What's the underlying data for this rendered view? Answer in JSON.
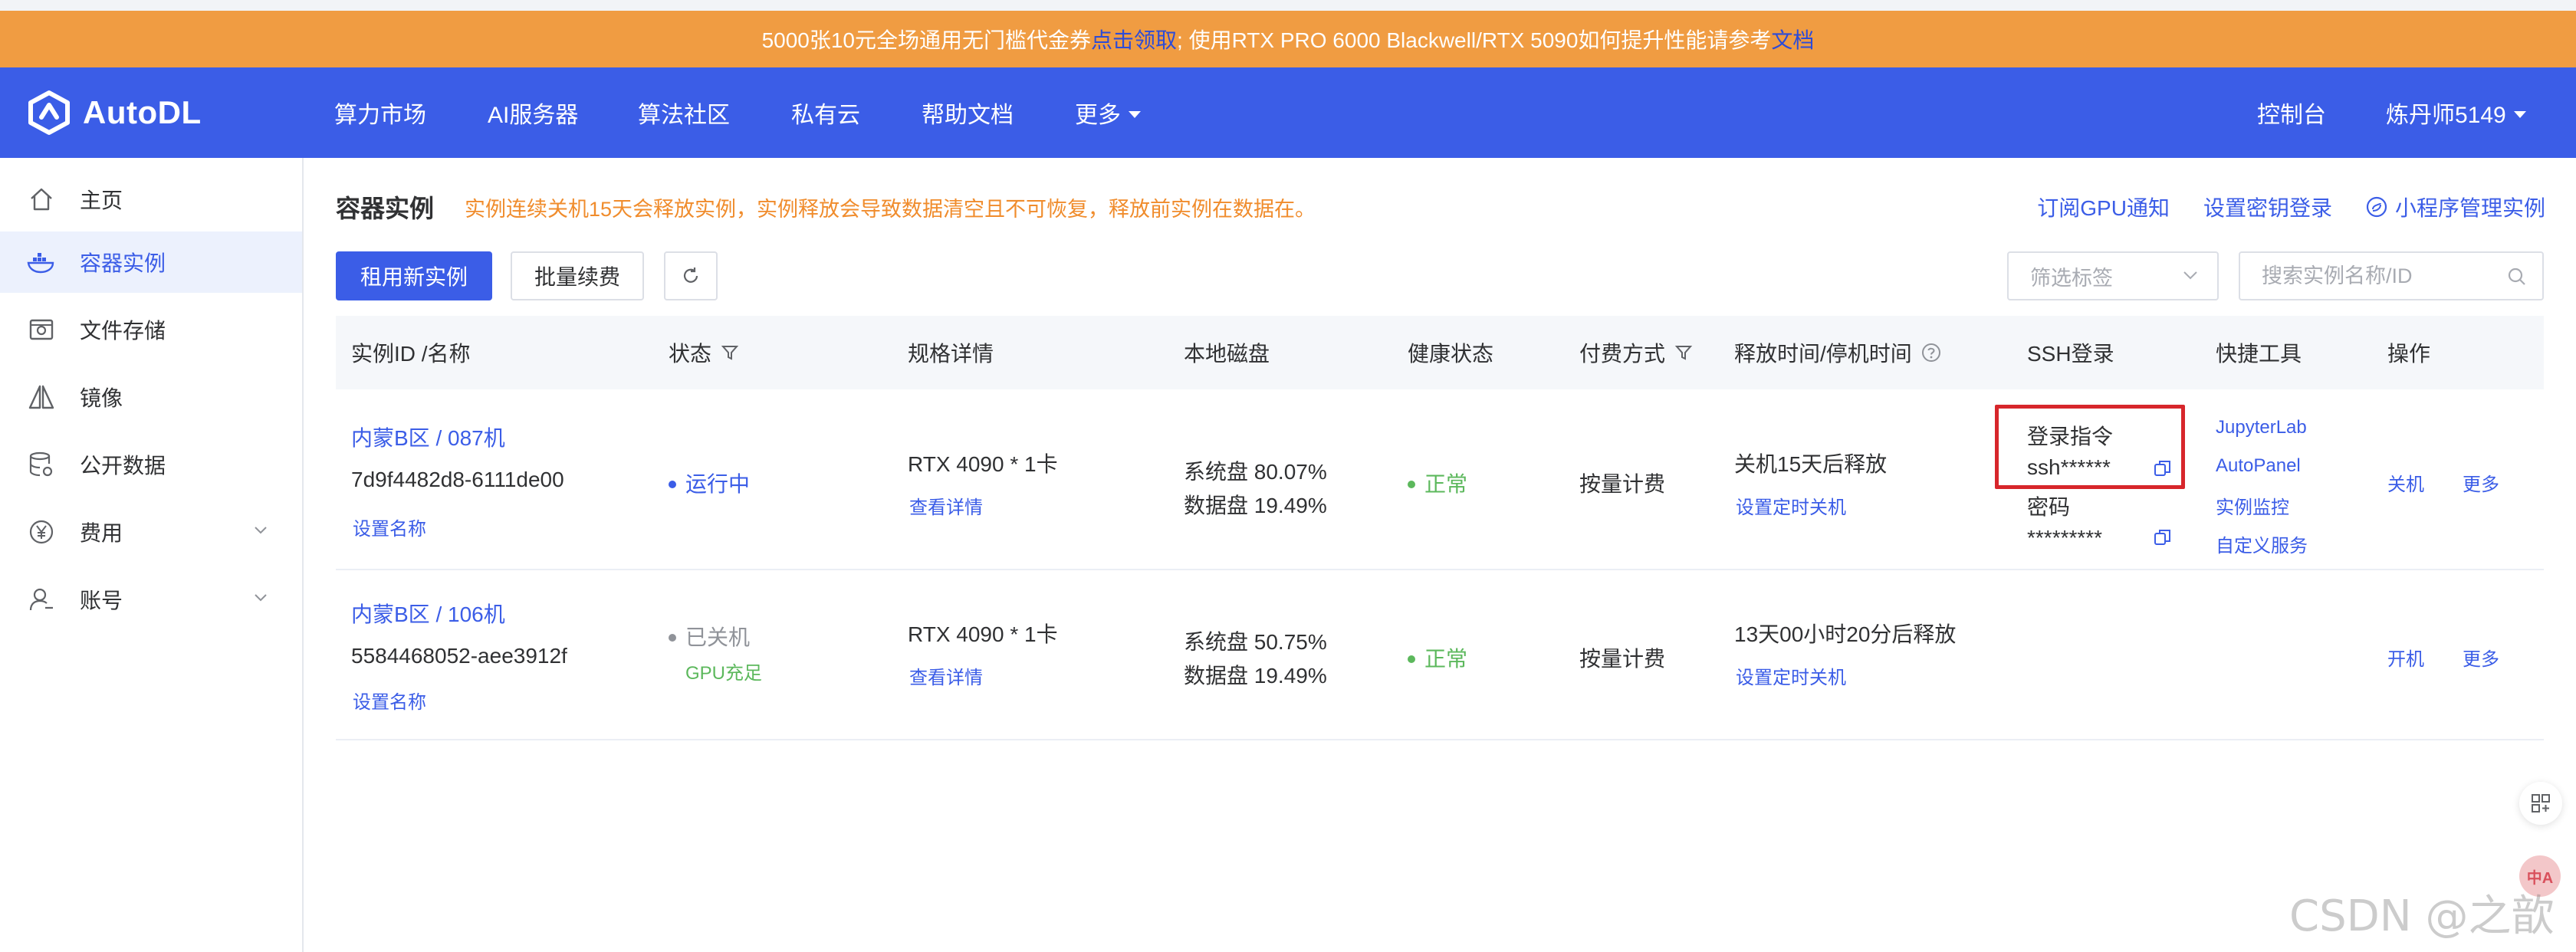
{
  "banner": {
    "part1": "5000张10元全场通用无门槛代金券",
    "link1": "点击领取",
    "part2": "; 使用RTX PRO 6000 Blackwell/RTX 5090如何提升性能请参考",
    "link2": "文档"
  },
  "topnav": {
    "logo_text": "AutoDL",
    "items": [
      "算力市场",
      "AI服务器",
      "算法社区",
      "私有云",
      "帮助文档",
      "更多"
    ],
    "console": "控制台",
    "user": "炼丹师5149"
  },
  "sidebar": {
    "items": [
      {
        "label": "主页",
        "icon": "home-icon"
      },
      {
        "label": "容器实例",
        "icon": "container-icon"
      },
      {
        "label": "文件存储",
        "icon": "storage-icon"
      },
      {
        "label": "镜像",
        "icon": "image-icon"
      },
      {
        "label": "公开数据",
        "icon": "database-icon"
      },
      {
        "label": "费用",
        "icon": "yen-icon"
      },
      {
        "label": "账号",
        "icon": "user-icon"
      }
    ]
  },
  "main": {
    "title": "容器实例",
    "warning": "实例连续关机15天会释放实例，实例释放会导致数据清空且不可恢复，释放前实例在数据在。",
    "links": {
      "subscribe": "订阅GPU通知",
      "ssh_key": "设置密钥登录",
      "miniprogram": "小程序管理实例"
    },
    "buttons": {
      "new_instance": "租用新实例",
      "batch_renew": "批量续费"
    },
    "filter_placeholder": "筛选标签",
    "search_placeholder": "搜索实例名称/ID"
  },
  "table": {
    "headers": {
      "id_name": "实例ID /名称",
      "status": "状态",
      "spec": "规格详情",
      "disk": "本地磁盘",
      "health": "健康状态",
      "billing": "付费方式",
      "release": "释放时间/停机时间",
      "ssh": "SSH登录",
      "tools": "快捷工具",
      "ops": "操作"
    },
    "rows": [
      {
        "name": "内蒙B区 / 087机",
        "id": "7d9f4482d8-6111de00",
        "set_name": "设置名称",
        "status": "运行中",
        "status_color": "#3b5de7",
        "gpu_note": "",
        "spec": "RTX 4090 * 1卡",
        "spec_link": "查看详情",
        "sys_disk": "系统盘 80.07%",
        "data_disk": "数据盘 19.49%",
        "health": "正常",
        "billing": "按量计费",
        "release": "关机15天后释放",
        "timer": "设置定时关机",
        "ssh_cmd_label": "登录指令",
        "ssh_cmd": "ssh******",
        "pwd_label": "密码",
        "pwd": "*********",
        "tools": [
          "JupyterLab",
          "AutoPanel",
          "实例监控",
          "自定义服务"
        ],
        "op_primary": "关机",
        "op_more": "更多"
      },
      {
        "name": "内蒙B区 / 106机",
        "id": "5584468052-aee3912f",
        "set_name": "设置名称",
        "status": "已关机",
        "status_color": "#909399",
        "gpu_note": "GPU充足",
        "spec": "RTX 4090 * 1卡",
        "spec_link": "查看详情",
        "sys_disk": "系统盘 50.75%",
        "data_disk": "数据盘 19.49%",
        "health": "正常",
        "billing": "按量计费",
        "release": "13天00小时20分后释放",
        "timer": "设置定时关机",
        "op_primary": "开机",
        "op_more": "更多"
      }
    ]
  },
  "float": {
    "badge": "中A"
  },
  "watermark": "CSDN @之歆"
}
